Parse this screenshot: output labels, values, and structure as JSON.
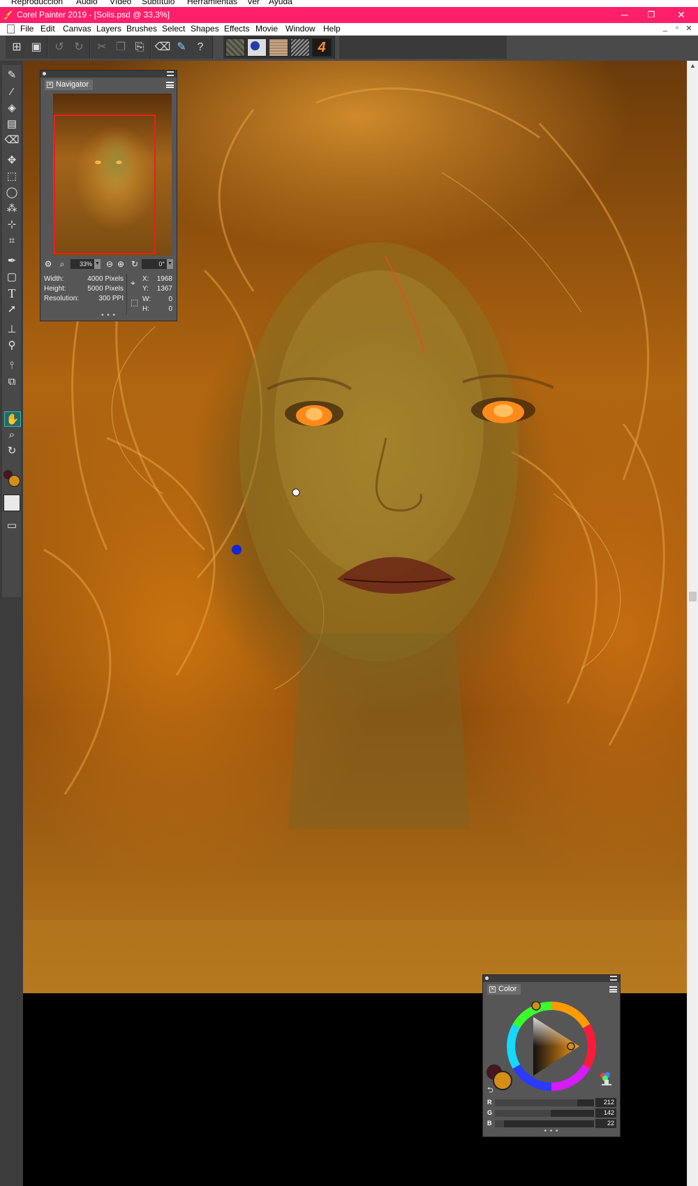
{
  "os_menu": {
    "items": [
      "Reproducción",
      "Audio",
      "Vídeo",
      "Subtítulo",
      "Herramientas",
      "Ver",
      "Ayuda"
    ]
  },
  "window": {
    "title": "Corel Painter 2019 - [Solis.psd @ 33,3%]",
    "minimize": "─",
    "maximize": "❐",
    "close": "✕",
    "title_bar_color": "#ff1f6b"
  },
  "menubar": {
    "items": [
      "File",
      "Edit",
      "Canvas",
      "Layers",
      "Brushes",
      "Select",
      "Shapes",
      "Effects",
      "Movie",
      "Window",
      "Help"
    ],
    "doc_controls": [
      "_",
      "▫",
      "✕"
    ]
  },
  "toolbar": {
    "icons": [
      "new-document-icon",
      "save-icon",
      "undo-icon",
      "redo-icon",
      "cut-icon",
      "copy-icon",
      "paste-icon",
      "eraser-icon",
      "brush-selector-icon",
      "help-icon"
    ],
    "swatches": [
      "paper-texture",
      "flow-map",
      "paper-library",
      "pattern",
      "brush-variant"
    ]
  },
  "toolbox": {
    "tools": [
      "brush",
      "dropper",
      "paint-bucket",
      "gradient",
      "eraser",
      "layer-adjuster",
      "rectangular-selection",
      "lasso",
      "magic-wand",
      "transform",
      "crop",
      "pen",
      "rectangle-shape",
      "text",
      "shape-selection",
      "cloner",
      "dodge",
      "mirror",
      "perspective",
      "grabber",
      "magnifier",
      "rotate-page",
      "main-secondary-color",
      "paper",
      "screen-mode"
    ],
    "selected": "grabber",
    "main_color": "#d48e16",
    "secondary_color": "#4a1422"
  },
  "navigator": {
    "tab_label": "Navigator",
    "zoom_value": "33%",
    "rotation_value": "0°",
    "width_label": "Width:",
    "width_value": "4000 Pixels",
    "height_label": "Height:",
    "height_value": "5000 Pixels",
    "resolution_label": "Resolution:",
    "resolution_value": "300 PPI",
    "x_label": "X:",
    "x_value": "1968",
    "y_label": "Y:",
    "y_value": "1367",
    "w_label": "W:",
    "w_value": "0",
    "h_label": "H:",
    "h_value": "0",
    "footer": "• • •"
  },
  "color_panel": {
    "tab_label": "Color",
    "main_color": "#d48e16",
    "secondary_color": "#4a1422",
    "rows": [
      {
        "label": "R",
        "value": "212",
        "fill": 0.83
      },
      {
        "label": "G",
        "value": "142",
        "fill": 0.56
      },
      {
        "label": "B",
        "value": "22",
        "fill": 0.09
      }
    ],
    "footer": "• • •"
  },
  "canvas": {
    "background": "#000000",
    "artwork_description_colors": [
      "#d48e16",
      "#9c7020",
      "#c9730f"
    ]
  }
}
